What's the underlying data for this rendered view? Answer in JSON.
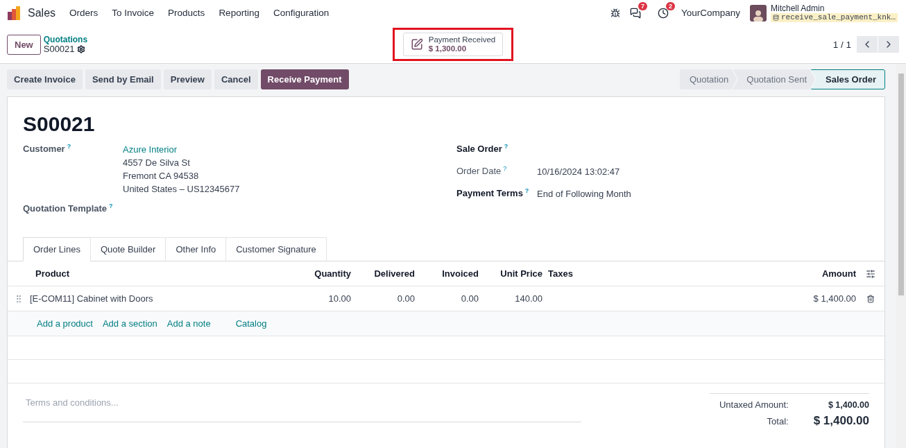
{
  "navbar": {
    "app": "Sales",
    "menu": [
      "Orders",
      "To Invoice",
      "Products",
      "Reporting",
      "Configuration"
    ],
    "messages_count": "7",
    "activities_count": "2",
    "company": "YourCompany",
    "user": "Mitchell Admin",
    "database": "receive_sale_payment_knk…"
  },
  "control_panel": {
    "new_button": "New",
    "breadcrumb": "Quotations",
    "record": "S00021",
    "smart_button": {
      "label": "Payment Received",
      "value": "$ 1,300.00",
      "highlighted": true
    },
    "pager": "1 / 1"
  },
  "actions": [
    {
      "label": "Create Invoice",
      "primary": false
    },
    {
      "label": "Send by Email",
      "primary": false
    },
    {
      "label": "Preview",
      "primary": false
    },
    {
      "label": "Cancel",
      "primary": false
    },
    {
      "label": "Receive Payment",
      "primary": true
    }
  ],
  "status_steps": [
    {
      "label": "Quotation",
      "selected": false
    },
    {
      "label": "Quotation Sent",
      "selected": false
    },
    {
      "label": "Sales Order",
      "selected": true
    }
  ],
  "form": {
    "title": "S00021",
    "customer": {
      "label": "Customer",
      "help": "?",
      "name": "Azure Interior",
      "address": [
        "4557 De Silva St",
        "Fremont CA 94538",
        "United States – US12345677"
      ]
    },
    "template": {
      "label": "Quotation Template",
      "help": "?"
    },
    "right_fields": [
      {
        "label": "Sale Order",
        "help": "?",
        "strong": true
      },
      {
        "label": "Order Date",
        "help": "?",
        "strong": false,
        "value": "10/16/2024 13:02:47"
      },
      {
        "label": "Payment Terms",
        "help": "?",
        "strong": true,
        "value": "End of Following Month"
      }
    ]
  },
  "tabs": [
    {
      "label": "Order Lines",
      "selected": true
    },
    {
      "label": "Quote Builder",
      "selected": false
    },
    {
      "label": "Other Info",
      "selected": false
    },
    {
      "label": "Customer Signature",
      "selected": false
    }
  ],
  "order_lines": {
    "columns": [
      "Product",
      "Quantity",
      "Delivered",
      "Invoiced",
      "Unit Price",
      "Taxes",
      "Amount"
    ],
    "rows": [
      {
        "product": "[E-COM11] Cabinet with Doors",
        "quantity": "10.00",
        "delivered": "0.00",
        "invoiced": "0.00",
        "unit_price": "140.00",
        "amount": "$ 1,400.00"
      }
    ],
    "add_links": [
      "Add a product",
      "Add a section",
      "Add a note",
      "Catalog"
    ]
  },
  "footer": {
    "terms_placeholder": "Terms and conditions...",
    "totals": [
      {
        "label": "Untaxed Amount:",
        "value": "$ 1,400.00",
        "kind": "subtotal"
      },
      {
        "label": "Total:",
        "value": "$ 1,400.00",
        "kind": "total"
      }
    ]
  }
}
